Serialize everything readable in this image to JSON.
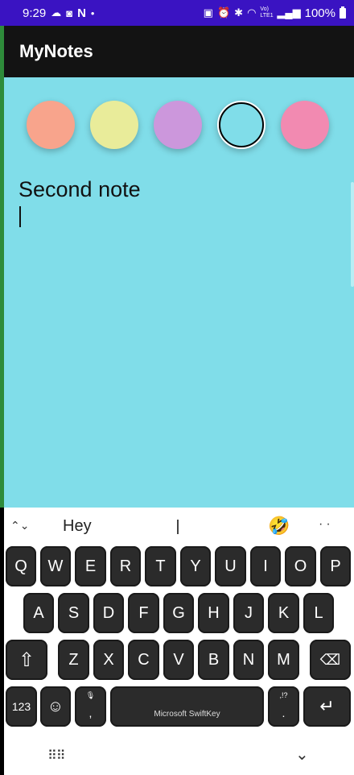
{
  "status_bar": {
    "time": "9:29",
    "left_icons": [
      "cloud-icon",
      "instagram-icon",
      "netflix-icon",
      "dot-icon"
    ],
    "netflix_glyph": "N",
    "battery": "100%",
    "right_icons": [
      "nfc-icon",
      "alarm-icon",
      "bluetooth-icon",
      "wifi-icon",
      "signal-icon",
      "battery-icon"
    ],
    "volte_label": "Vo) LTE1"
  },
  "app": {
    "title": "MyNotes"
  },
  "colors": {
    "swatches": [
      "#f8a48c",
      "#e9ec9a",
      "#cc97dc",
      "#80dde9",
      "#f28ab1"
    ],
    "selected_index": 3
  },
  "note": {
    "text": "Second note"
  },
  "keyboard": {
    "suggestion": "Hey",
    "suggestion_emoji": "🤣",
    "rows": [
      [
        "Q",
        "W",
        "E",
        "R",
        "T",
        "Y",
        "U",
        "I",
        "O",
        "P"
      ],
      [
        "A",
        "S",
        "D",
        "F",
        "G",
        "H",
        "J",
        "K",
        "L"
      ],
      [
        "Z",
        "X",
        "C",
        "V",
        "B",
        "N",
        "M"
      ]
    ],
    "numbers_key": "123",
    "space_label": "Microsoft SwiftKey",
    "comma_key": ",",
    "period_key": ".",
    "punct_hint": ",!?",
    "emoji_key": "☺"
  }
}
